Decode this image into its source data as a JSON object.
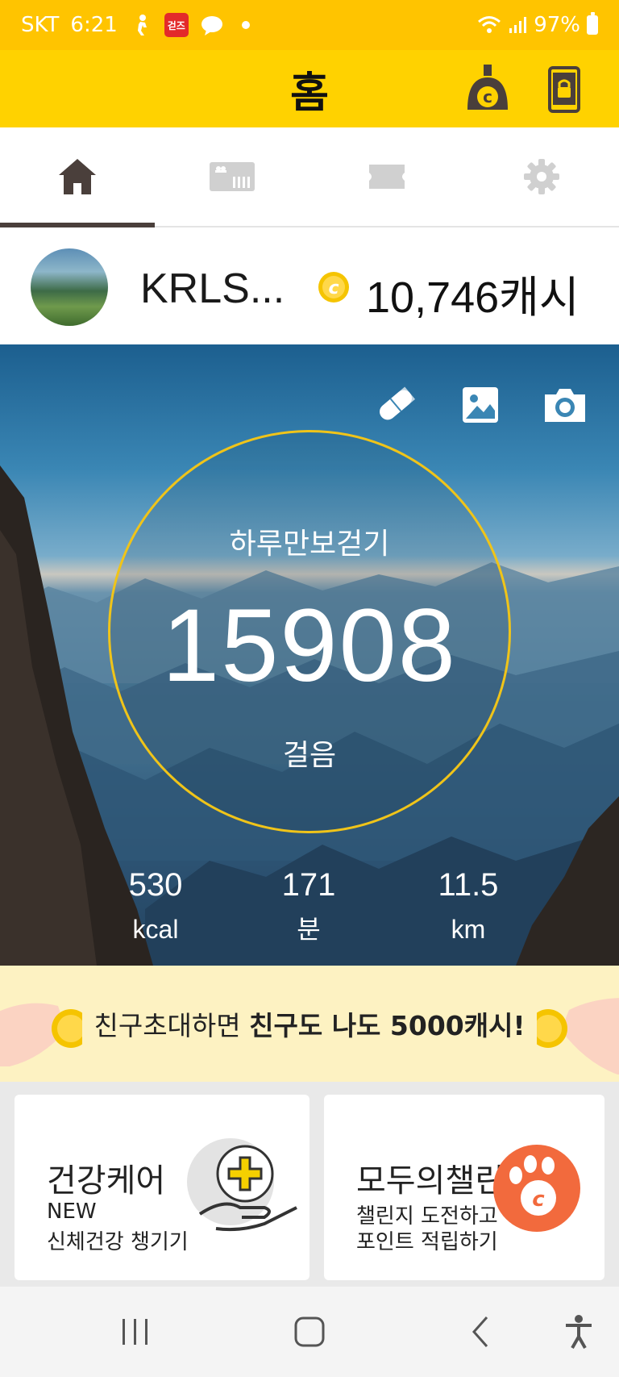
{
  "status_bar": {
    "carrier": "SKT",
    "time": "6:21",
    "notification_badge": "걷즈",
    "battery": "97%"
  },
  "header": {
    "title": "홈",
    "icons": [
      "cash-character-icon",
      "phone-lock-icon"
    ]
  },
  "tabs": [
    {
      "name": "home",
      "icon": "home-icon",
      "active": true
    },
    {
      "name": "store",
      "icon": "gift-card-icon",
      "active": false
    },
    {
      "name": "coupon",
      "icon": "ticket-icon",
      "active": false
    },
    {
      "name": "settings",
      "icon": "gear-icon",
      "active": false
    }
  ],
  "profile": {
    "username": "KRLS...",
    "cash": "10,746캐시",
    "coin_color": "#f5c400"
  },
  "hero": {
    "title": "하루만보걷기",
    "steps": "15908",
    "steps_unit": "걸음",
    "ring_color": "#f0c419",
    "tools": [
      "pill-icon",
      "image-icon",
      "camera-icon"
    ],
    "stats": [
      {
        "value": "530",
        "label": "kcal"
      },
      {
        "value": "171",
        "label": "분"
      },
      {
        "value": "11.5",
        "label": "km"
      }
    ]
  },
  "banner": {
    "text_normal": "친구초대하면 ",
    "text_bold": "친구도 나도 5000캐시!"
  },
  "cards": [
    {
      "title": "건강케어",
      "line1": "NEW",
      "line2": "신체건강 챙기기"
    },
    {
      "title": "모두의챌린지",
      "line1": "챌린지 도전하고",
      "line2": "포인트 적립하기"
    }
  ],
  "colors": {
    "primary_yellow": "#ffd200",
    "status_yellow": "#ffc400",
    "accent_orange": "#f26a3d",
    "tab_active": "#4a3f3b"
  }
}
